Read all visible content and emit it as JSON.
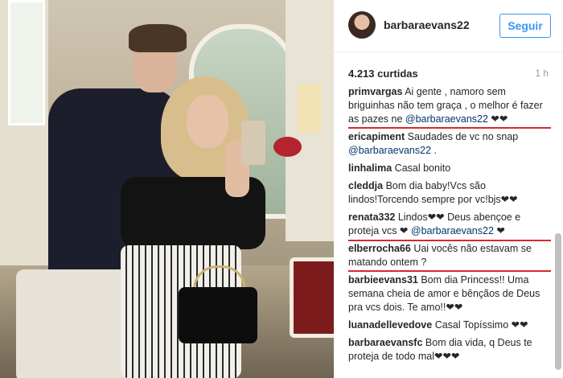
{
  "header": {
    "username": "barbaraevans22",
    "follow_label": "Seguir"
  },
  "post": {
    "likes": "4.213 curtidas",
    "time": "1 h"
  },
  "comments": [
    {
      "user": "primvargas",
      "text": "Ai gente , namoro sem briguinhas não tem graça , o melhor é fazer as pazes ne ",
      "mention": "@barbaraevans22",
      "suffix": " ❤❤"
    },
    {
      "user": "ericapiment",
      "text": "Saudades de vc no snap ",
      "mention": "@barbaraevans22",
      "suffix": " ."
    },
    {
      "user": "linhalima",
      "text": "Casal bonito",
      "mention": "",
      "suffix": ""
    },
    {
      "user": "cleddja",
      "text": "Bom dia baby!Vcs são lindos!Torcendo sempre por vc!bjs❤❤",
      "mention": "",
      "suffix": ""
    },
    {
      "user": "renata332",
      "text": "Lindos❤❤ Deus abençoe e proteja vcs ❤ ",
      "mention": "@barbaraevans22",
      "suffix": " ❤"
    },
    {
      "user": "elberrocha66",
      "text": "Uai vocês não estavam se matando ontem ?",
      "mention": "",
      "suffix": ""
    },
    {
      "user": "barbieevans31",
      "text": "Bom dia Princess!! Uma semana cheia de amor e bênçãos de Deus pra vcs dois. Te amo!!❤❤",
      "mention": "",
      "suffix": ""
    },
    {
      "user": "luanadellevedove",
      "text": "Casal Topíssimo ❤❤",
      "mention": "",
      "suffix": ""
    },
    {
      "user": "barbaraevansfc",
      "text": "Bom dia vida, q Deus te proteja de todo mal❤❤❤",
      "mention": "",
      "suffix": ""
    }
  ],
  "icons": {
    "avatar": "profile-avatar",
    "scroll": "scrollbar"
  },
  "colors": {
    "follow": "#3897f0",
    "highlight": "#d7282f",
    "mention": "#003569"
  }
}
